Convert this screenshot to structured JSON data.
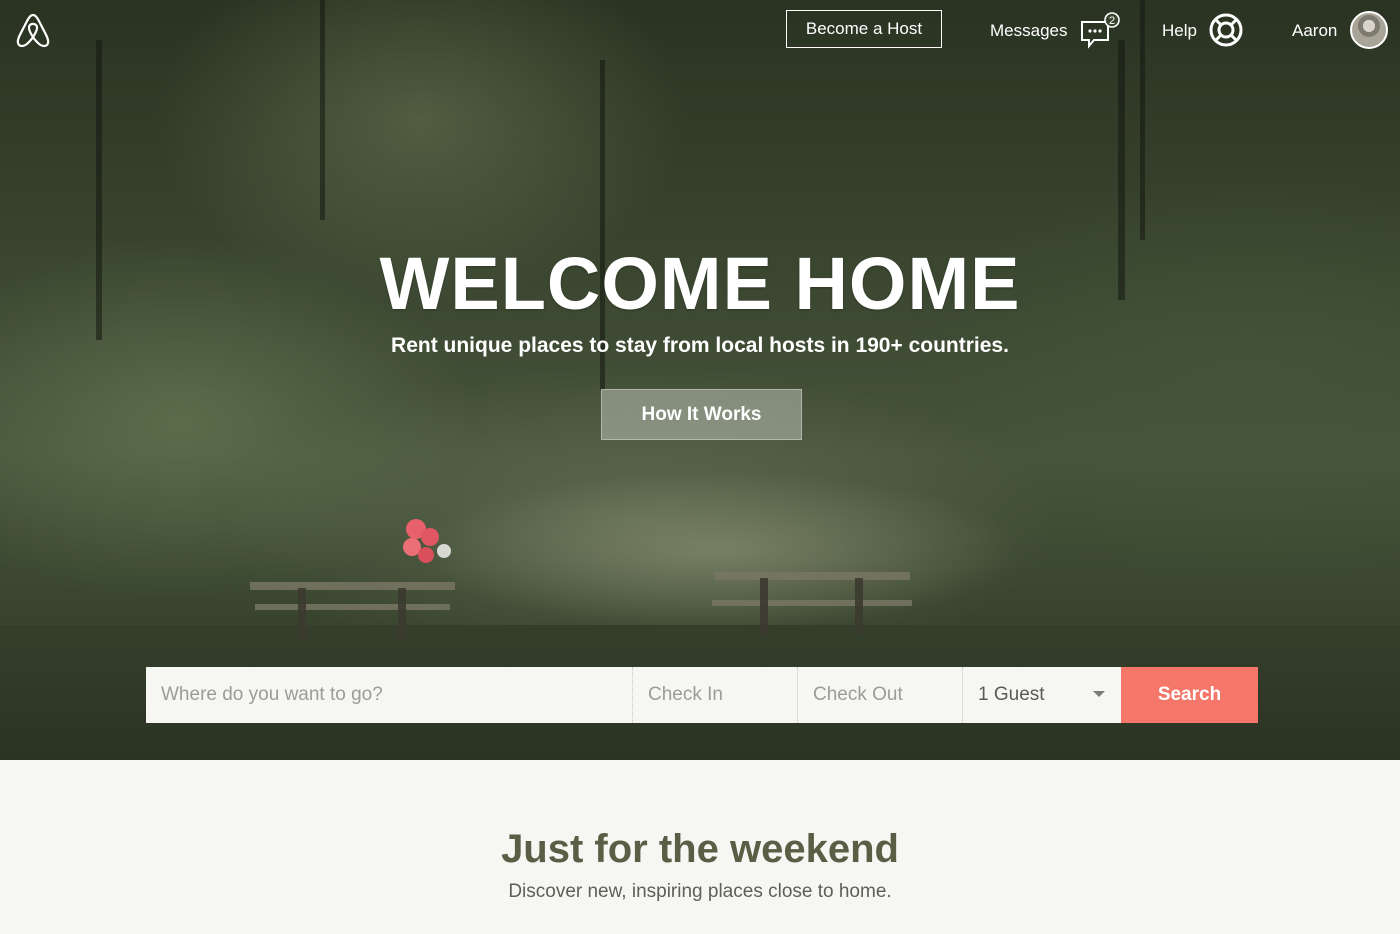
{
  "nav": {
    "logo_icon": "airbnb-logo-icon",
    "become_host_label": "Become a Host",
    "messages_label": "Messages",
    "messages_icon": "chat-bubble-icon",
    "messages_count": "2",
    "help_label": "Help",
    "help_icon": "lifebuoy-icon",
    "user_name": "Aaron",
    "avatar_icon": "user-avatar"
  },
  "hero": {
    "title": "WELCOME HOME",
    "subtitle": "Rent unique places to stay from local hosts in 190+ countries.",
    "cta_label": "How It Works"
  },
  "search": {
    "where_placeholder": "Where do you want to go?",
    "checkin_placeholder": "Check In",
    "checkout_placeholder": "Check Out",
    "guests_value": "1 Guest",
    "button_label": "Search",
    "button_color": "#f4776a"
  },
  "featured": {
    "title": "Just for the weekend",
    "subtitle": "Discover new, inspiring places close to home."
  }
}
